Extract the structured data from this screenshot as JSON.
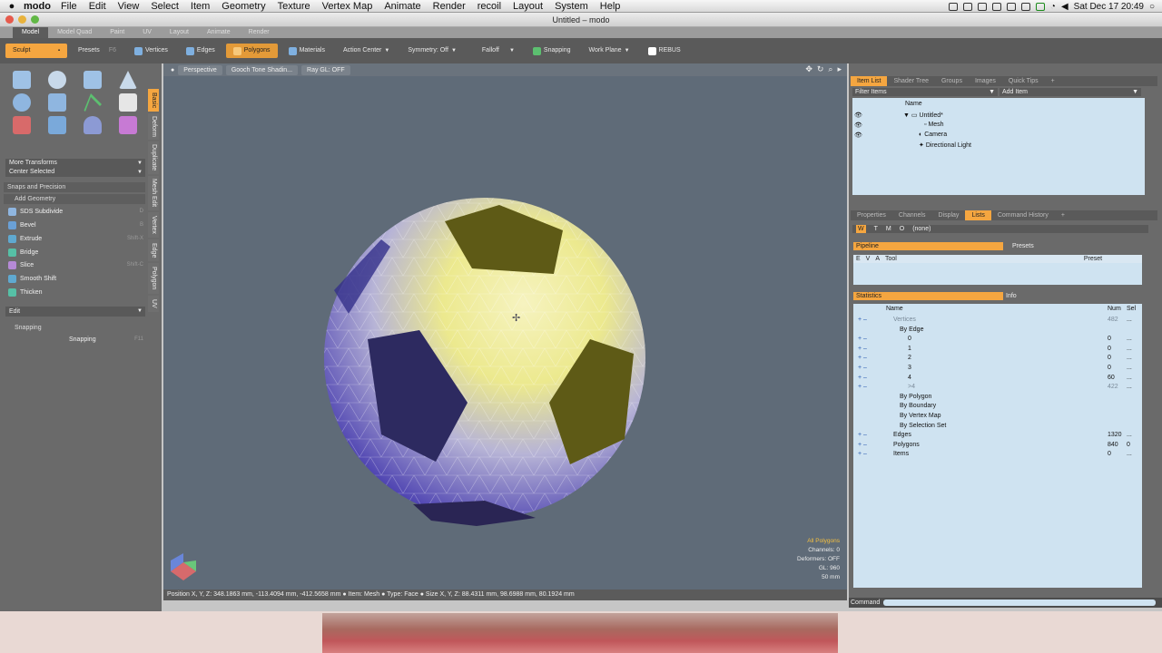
{
  "os_menu": {
    "app_name": "modo",
    "items": [
      "File",
      "Edit",
      "View",
      "Select",
      "Item",
      "Geometry",
      "Texture",
      "Vertex Map",
      "Animate",
      "Render",
      "recoil",
      "Layout",
      "System",
      "Help"
    ],
    "clock": "Sat Dec 17  20:49"
  },
  "window": {
    "title": "Untitled – modo"
  },
  "layout_tabs": [
    "Model",
    "Model Quad",
    "Paint",
    "UV",
    "Layout",
    "Animate",
    "Render"
  ],
  "toolbar": {
    "sculpt": "Sculpt",
    "presets": "Presets",
    "presets_key": "F6",
    "vertices": "Vertices",
    "edges": "Edges",
    "polygons": "Polygons",
    "materials": "Materials",
    "action_center": "Action Center",
    "symmetry": "Symmetry: Off",
    "falloff": "Falloff",
    "snapping": "Snapping",
    "work_plane": "Work Plane",
    "rebus": "REBUS"
  },
  "left_panel": {
    "more_transforms": "More Transforms",
    "center_selected": "Center Selected",
    "snaps_precision": "Snaps and Precision",
    "add_geometry": "Add Geometry",
    "tools": [
      {
        "label": "SDS Subdivide",
        "shortcut": "D",
        "color": "#8fb6e0"
      },
      {
        "label": "Bevel",
        "shortcut": "B",
        "color": "#6aa0d6"
      },
      {
        "label": "Extrude",
        "shortcut": "Shift-X",
        "color": "#5fa9d0"
      },
      {
        "label": "Bridge",
        "shortcut": "",
        "color": "#56c0a6"
      },
      {
        "label": "Slice",
        "shortcut": "Shift-C",
        "color": "#b58ad6"
      },
      {
        "label": "Smooth Shift",
        "shortcut": "",
        "color": "#5fa9d0"
      },
      {
        "label": "Thicken",
        "shortcut": "",
        "color": "#56c0a6"
      }
    ],
    "edit": "Edit",
    "snapping_section": "Snapping",
    "snapping_item": "Snapping",
    "snapping_key": "F11",
    "vertical_tabs": [
      "Basic",
      "Deform",
      "Duplicate",
      "Mesh Edit",
      "Vertex",
      "Edge",
      "Polygon",
      "UV"
    ]
  },
  "viewport": {
    "view": "Perspective",
    "shading": "Gooch Tone Shadin...",
    "raygl": "Ray GL: OFF",
    "stats": [
      "All Polygons",
      "Channels: 0",
      "Deformers: OFF",
      "GL: 960",
      "50 mm"
    ]
  },
  "status_bar": "Position X, Y, Z:   348.1863 mm, -113.4094 mm, -412.5658 mm ● Item:  Mesh ● Type:  Face ● Size X, Y, Z:   88.4311 mm, 98.6988 mm, 80.1924 mm",
  "item_list": {
    "tabs": [
      "Item List",
      "Shader Tree",
      "Groups",
      "Images",
      "Quick Tips"
    ],
    "filter": "Filter Items",
    "add_item": "Add Item",
    "name_header": "Name",
    "items": [
      "Untitled*",
      "Mesh",
      "Camera",
      "Directional Light"
    ]
  },
  "props": {
    "tabs": [
      "Properties",
      "Channels",
      "Display",
      "Lists",
      "Command History"
    ],
    "mode_buttons": [
      "W",
      "T",
      "M",
      "O"
    ],
    "mode_value": "(none)",
    "pipeline": "Pipeline",
    "presets": "Presets",
    "cols": [
      "E",
      "V",
      "A",
      "Tool",
      "Preset"
    ],
    "statistics": "Statistics",
    "info": "Info",
    "stat_headers": [
      "Name",
      "Num",
      "Sel"
    ],
    "stats": [
      {
        "name": "Vertices",
        "num": "482",
        "sel": "...",
        "indent": 0,
        "dim": true
      },
      {
        "name": "By Edge",
        "num": "",
        "sel": "",
        "indent": 1,
        "dim": false
      },
      {
        "name": "0",
        "num": "0",
        "sel": "...",
        "indent": 2,
        "dim": false
      },
      {
        "name": "1",
        "num": "0",
        "sel": "...",
        "indent": 2,
        "dim": false
      },
      {
        "name": "2",
        "num": "0",
        "sel": "...",
        "indent": 2,
        "dim": false
      },
      {
        "name": "3",
        "num": "0",
        "sel": "...",
        "indent": 2,
        "dim": false
      },
      {
        "name": "4",
        "num": "60",
        "sel": "...",
        "indent": 2,
        "dim": false
      },
      {
        "name": ">4",
        "num": "422",
        "sel": "...",
        "indent": 2,
        "dim": true
      },
      {
        "name": "By Polygon",
        "num": "",
        "sel": "",
        "indent": 1,
        "dim": false
      },
      {
        "name": "By Boundary",
        "num": "",
        "sel": "",
        "indent": 1,
        "dim": false
      },
      {
        "name": "By Vertex Map",
        "num": "",
        "sel": "",
        "indent": 1,
        "dim": false
      },
      {
        "name": "By Selection Set",
        "num": "",
        "sel": "",
        "indent": 1,
        "dim": false
      },
      {
        "name": "Edges",
        "num": "1320",
        "sel": "...",
        "indent": 0,
        "dim": false
      },
      {
        "name": "Polygons",
        "num": "840",
        "sel": "0",
        "indent": 0,
        "dim": false
      },
      {
        "name": "Items",
        "num": "0",
        "sel": "...",
        "indent": 0,
        "dim": false
      }
    ]
  },
  "command": {
    "label": "Command"
  }
}
